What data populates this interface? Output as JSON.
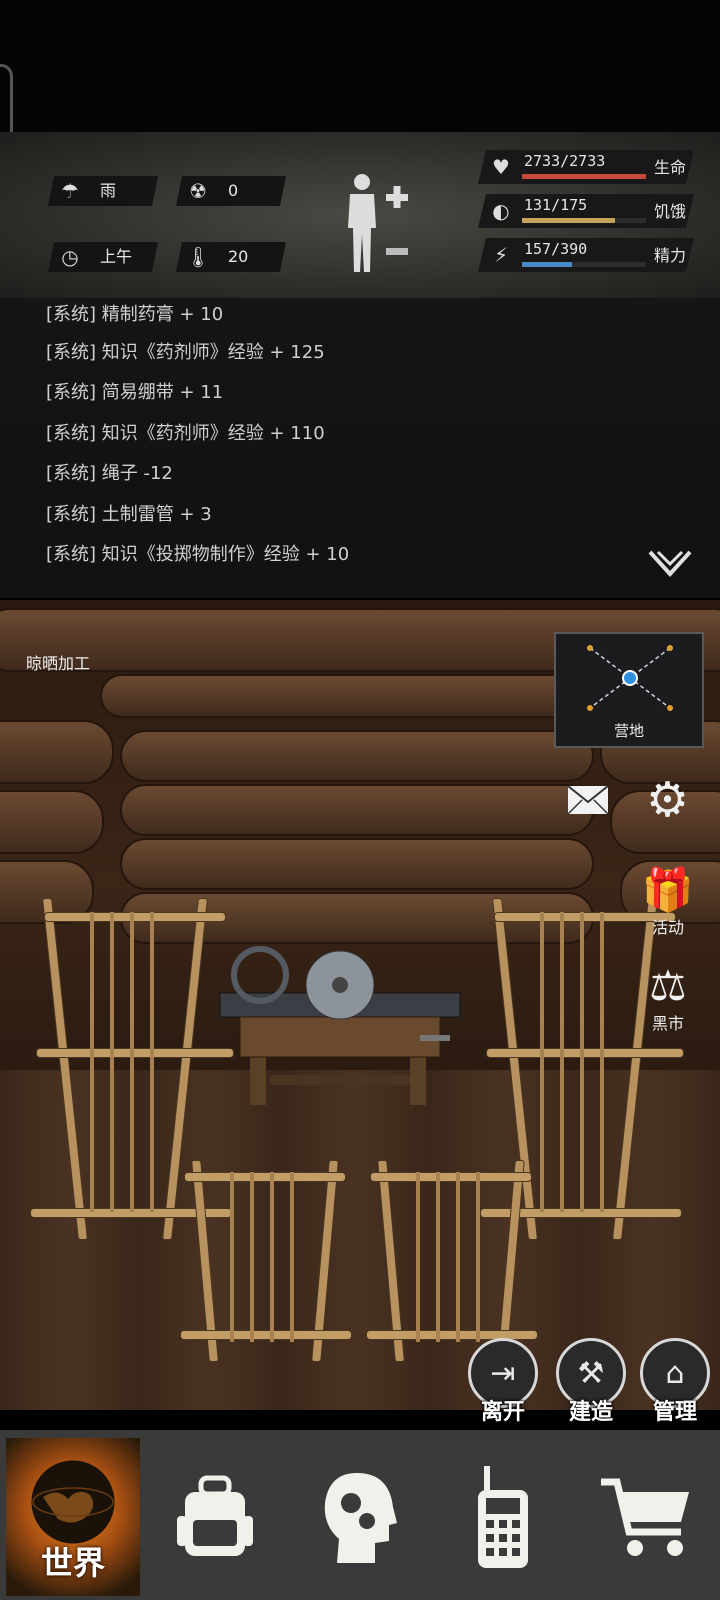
{
  "status": {
    "weather": "雨",
    "radiation": "0",
    "time_of_day": "上午",
    "temperature": "20"
  },
  "stats": [
    {
      "name": "health",
      "value": "2733/2733",
      "label": "生命",
      "fraction": 1.0,
      "color": "#c84a3c",
      "icon": "heart-pulse-icon"
    },
    {
      "name": "hunger",
      "value": "131/175",
      "label": "饥饿",
      "fraction": 0.749,
      "color": "#c4a25a",
      "icon": "stomach-icon"
    },
    {
      "name": "energy",
      "value": "157/390",
      "label": "精力",
      "fraction": 0.403,
      "color": "#4a8ac8",
      "icon": "energy-head-icon"
    }
  ],
  "log": [
    "[系统] 精制药膏 + 10",
    "[系统] 知识《药剂师》经验 + 125",
    "[系统] 简易绷带 + 11",
    "[系统] 知识《药剂师》经验 + 110",
    "[系统] 绳子 -12",
    "[系统] 土制雷管 + 3",
    "[系统] 知识《投掷物制作》经验 + 10"
  ],
  "location_label": "晾晒加工",
  "minimap_label": "营地",
  "side_buttons": {
    "mail_icon": "mail-icon",
    "settings_icon": "gear-icon",
    "activity": "活动",
    "black_market": "黑市"
  },
  "actions": {
    "leave": "离开",
    "build": "建造",
    "manage": "管理"
  },
  "nav": {
    "world": "世界"
  }
}
